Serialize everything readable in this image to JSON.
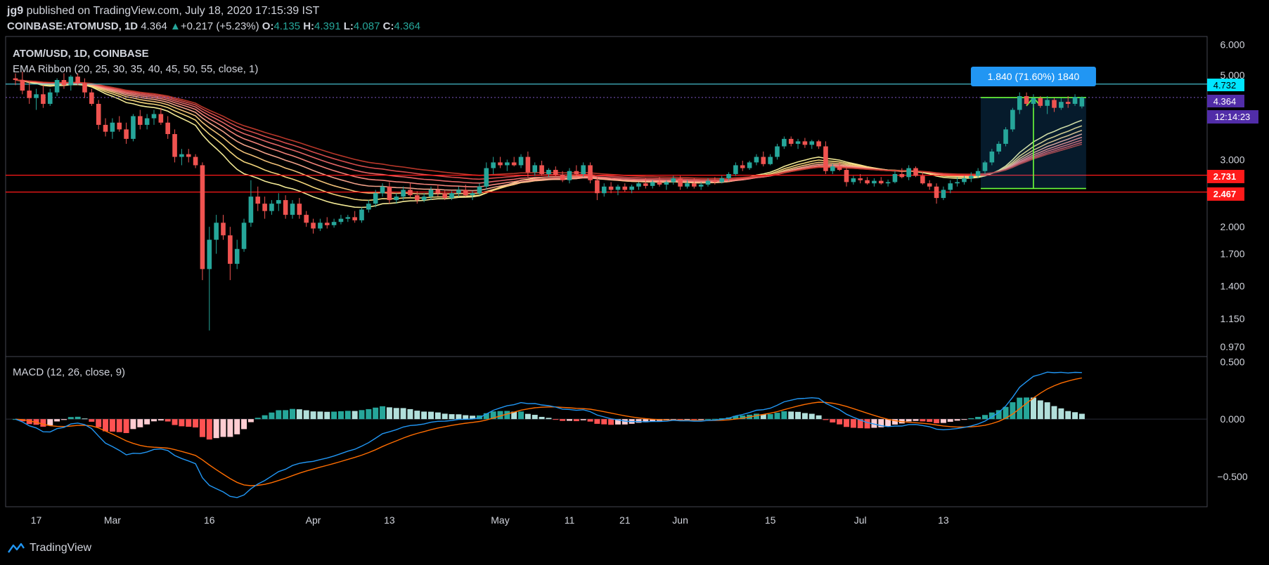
{
  "header": {
    "user": "jg9",
    "published": "published on TradingView.com, July 18, 2020 17:15:39 IST",
    "symbol": "COINBASE:ATOMUSD, 1D",
    "last": "4.364",
    "change_arrow": "▲",
    "change": "+0.217 (+5.23%)",
    "o_label": "O:",
    "o": "4.135",
    "h_label": "H:",
    "h": "4.391",
    "l_label": "L:",
    "l": "4.087",
    "c_label": "C:",
    "c": "4.364"
  },
  "price_pane": {
    "title": "ATOM/USD, 1D, COINBASE",
    "indicator": "EMA Ribbon (20, 25, 30, 35, 40, 45, 50, 55, close, 1)",
    "measure_label": "1.840 (71.60%) 1840"
  },
  "macd_pane": {
    "title": "MACD (12, 26, close, 9)"
  },
  "price_tags": {
    "resistance": "4.732",
    "last": "4.364",
    "countdown": "12:14:23",
    "support1": "2.731",
    "support2": "2.467"
  },
  "footer": {
    "brand": "TradingView"
  },
  "colors": {
    "up": "#26a69a",
    "down": "#ef5350",
    "cyan": "#4dd0e1",
    "red_line": "#ff1a1a",
    "macd": "#2196f3",
    "signal": "#ff6d00",
    "measure": "#2196f3",
    "lime": "#6cff3a"
  },
  "chart_data": [
    {
      "type": "candlestick",
      "title": "ATOM/USD, 1D, COINBASE",
      "x_ticks": [
        "17",
        "Mar",
        "16",
        "Apr",
        "13",
        "May",
        "11",
        "21",
        "Jun",
        "15",
        "Jul",
        "13"
      ],
      "y_ticks": [
        "6.000",
        "5.000",
        "3.000",
        "2.000",
        "1.700",
        "1.400",
        "1.150",
        "0.970"
      ],
      "log_scale": true,
      "ylim": [
        0.93,
        6.2
      ],
      "horizontal_lines": [
        4.732,
        2.731,
        2.467
      ],
      "last_price": 4.364,
      "measure": {
        "from": 2.52,
        "to": 4.364,
        "label": "1.840 (71.60%) 1840"
      },
      "candles": [
        [
          4.9,
          5.05,
          4.7,
          4.85
        ],
        [
          4.85,
          5.1,
          4.45,
          4.55
        ],
        [
          4.55,
          4.8,
          4.2,
          4.35
        ],
        [
          4.35,
          4.6,
          4.05,
          4.45
        ],
        [
          4.45,
          4.7,
          4.1,
          4.2
        ],
        [
          4.2,
          4.6,
          4.15,
          4.5
        ],
        [
          4.5,
          4.9,
          4.4,
          4.85
        ],
        [
          4.85,
          5.05,
          4.6,
          4.7
        ],
        [
          4.7,
          5.0,
          4.55,
          4.95
        ],
        [
          4.95,
          5.05,
          4.7,
          4.75
        ],
        [
          4.75,
          4.9,
          4.35,
          4.5
        ],
        [
          4.5,
          4.6,
          4.15,
          4.2
        ],
        [
          4.2,
          4.3,
          3.6,
          3.7
        ],
        [
          3.7,
          3.85,
          3.45,
          3.55
        ],
        [
          3.55,
          3.85,
          3.4,
          3.75
        ],
        [
          3.75,
          3.9,
          3.55,
          3.6
        ],
        [
          3.6,
          3.75,
          3.3,
          3.4
        ],
        [
          3.4,
          3.95,
          3.35,
          3.9
        ],
        [
          3.9,
          4.05,
          3.6,
          3.7
        ],
        [
          3.7,
          3.95,
          3.6,
          3.85
        ],
        [
          3.85,
          4.05,
          3.7,
          3.95
        ],
        [
          3.95,
          4.1,
          3.7,
          3.75
        ],
        [
          3.75,
          3.9,
          3.4,
          3.5
        ],
        [
          3.5,
          3.6,
          2.95,
          3.05
        ],
        [
          3.05,
          3.2,
          2.9,
          3.1
        ],
        [
          3.1,
          3.2,
          2.95,
          3.05
        ],
        [
          3.05,
          3.1,
          2.85,
          2.9
        ],
        [
          2.9,
          2.95,
          1.45,
          1.55
        ],
        [
          1.55,
          2.0,
          1.07,
          1.85
        ],
        [
          1.85,
          2.15,
          1.7,
          2.05
        ],
        [
          2.05,
          2.15,
          1.85,
          1.9
        ],
        [
          1.9,
          2.0,
          1.45,
          1.6
        ],
        [
          1.6,
          1.85,
          1.55,
          1.75
        ],
        [
          1.75,
          2.1,
          1.72,
          2.05
        ],
        [
          2.05,
          2.65,
          2.0,
          2.4
        ],
        [
          2.4,
          2.55,
          2.2,
          2.3
        ],
        [
          2.3,
          2.4,
          2.1,
          2.2
        ],
        [
          2.2,
          2.35,
          2.15,
          2.3
        ],
        [
          2.3,
          2.45,
          2.2,
          2.35
        ],
        [
          2.35,
          2.42,
          2.1,
          2.15
        ],
        [
          2.15,
          2.35,
          2.1,
          2.3
        ],
        [
          2.3,
          2.38,
          2.1,
          2.15
        ],
        [
          2.15,
          2.2,
          2.0,
          2.05
        ],
        [
          2.05,
          2.1,
          1.92,
          1.98
        ],
        [
          1.98,
          2.1,
          1.95,
          2.05
        ],
        [
          2.05,
          2.12,
          1.98,
          2.02
        ],
        [
          2.02,
          2.1,
          1.99,
          2.06
        ],
        [
          2.06,
          2.15,
          2.03,
          2.1
        ],
        [
          2.1,
          2.15,
          2.06,
          2.12
        ],
        [
          2.12,
          2.2,
          2.05,
          2.08
        ],
        [
          2.08,
          2.25,
          2.05,
          2.22
        ],
        [
          2.22,
          2.35,
          2.18,
          2.3
        ],
        [
          2.3,
          2.5,
          2.25,
          2.45
        ],
        [
          2.45,
          2.6,
          2.4,
          2.55
        ],
        [
          2.55,
          2.62,
          2.3,
          2.35
        ],
        [
          2.35,
          2.45,
          2.3,
          2.4
        ],
        [
          2.4,
          2.55,
          2.35,
          2.5
        ],
        [
          2.5,
          2.6,
          2.38,
          2.42
        ],
        [
          2.42,
          2.48,
          2.3,
          2.35
        ],
        [
          2.35,
          2.45,
          2.32,
          2.4
        ],
        [
          2.4,
          2.55,
          2.35,
          2.5
        ],
        [
          2.5,
          2.58,
          2.4,
          2.45
        ],
        [
          2.45,
          2.5,
          2.35,
          2.38
        ],
        [
          2.38,
          2.48,
          2.35,
          2.45
        ],
        [
          2.45,
          2.55,
          2.4,
          2.5
        ],
        [
          2.5,
          2.58,
          2.4,
          2.42
        ],
        [
          2.42,
          2.48,
          2.35,
          2.45
        ],
        [
          2.45,
          2.6,
          2.42,
          2.55
        ],
        [
          2.55,
          2.95,
          2.5,
          2.85
        ],
        [
          2.85,
          3.05,
          2.75,
          2.95
        ],
        [
          2.95,
          3.05,
          2.85,
          2.9
        ],
        [
          2.9,
          3.0,
          2.8,
          2.95
        ],
        [
          2.95,
          3.05,
          2.88,
          2.9
        ],
        [
          2.9,
          3.1,
          2.85,
          3.05
        ],
        [
          3.05,
          3.15,
          2.7,
          2.78
        ],
        [
          2.78,
          2.95,
          2.72,
          2.9
        ],
        [
          2.9,
          2.98,
          2.72,
          2.75
        ],
        [
          2.75,
          2.85,
          2.7,
          2.82
        ],
        [
          2.82,
          2.88,
          2.7,
          2.74
        ],
        [
          2.74,
          2.8,
          2.62,
          2.65
        ],
        [
          2.65,
          2.85,
          2.6,
          2.8
        ],
        [
          2.8,
          2.9,
          2.72,
          2.75
        ],
        [
          2.75,
          2.95,
          2.7,
          2.9
        ],
        [
          2.9,
          2.95,
          2.6,
          2.65
        ],
        [
          2.65,
          2.7,
          2.35,
          2.45
        ],
        [
          2.45,
          2.6,
          2.4,
          2.55
        ],
        [
          2.55,
          2.62,
          2.45,
          2.5
        ],
        [
          2.5,
          2.58,
          2.42,
          2.55
        ],
        [
          2.55,
          2.6,
          2.47,
          2.5
        ],
        [
          2.5,
          2.58,
          2.45,
          2.55
        ],
        [
          2.55,
          2.62,
          2.5,
          2.6
        ],
        [
          2.6,
          2.68,
          2.52,
          2.56
        ],
        [
          2.56,
          2.65,
          2.52,
          2.62
        ],
        [
          2.62,
          2.7,
          2.55,
          2.58
        ],
        [
          2.58,
          2.65,
          2.5,
          2.62
        ],
        [
          2.62,
          2.72,
          2.58,
          2.68
        ],
        [
          2.68,
          2.72,
          2.5,
          2.55
        ],
        [
          2.55,
          2.65,
          2.52,
          2.6
        ],
        [
          2.6,
          2.68,
          2.52,
          2.55
        ],
        [
          2.55,
          2.62,
          2.5,
          2.58
        ],
        [
          2.58,
          2.68,
          2.55,
          2.64
        ],
        [
          2.64,
          2.7,
          2.58,
          2.62
        ],
        [
          2.62,
          2.72,
          2.6,
          2.68
        ],
        [
          2.68,
          2.78,
          2.64,
          2.75
        ],
        [
          2.75,
          2.95,
          2.72,
          2.9
        ],
        [
          2.9,
          2.98,
          2.8,
          2.85
        ],
        [
          2.85,
          2.98,
          2.82,
          2.95
        ],
        [
          2.95,
          3.1,
          2.9,
          3.05
        ],
        [
          3.05,
          3.15,
          2.88,
          2.92
        ],
        [
          2.92,
          3.1,
          2.9,
          3.05
        ],
        [
          3.05,
          3.3,
          3.0,
          3.25
        ],
        [
          3.25,
          3.45,
          3.2,
          3.4
        ],
        [
          3.4,
          3.45,
          3.25,
          3.3
        ],
        [
          3.3,
          3.4,
          3.2,
          3.35
        ],
        [
          3.35,
          3.42,
          3.22,
          3.28
        ],
        [
          3.28,
          3.38,
          3.2,
          3.35
        ],
        [
          3.35,
          3.38,
          3.2,
          3.25
        ],
        [
          3.25,
          3.35,
          2.75,
          2.8
        ],
        [
          2.8,
          2.92,
          2.75,
          2.88
        ],
        [
          2.88,
          2.95,
          2.8,
          2.82
        ],
        [
          2.82,
          2.88,
          2.55,
          2.62
        ],
        [
          2.62,
          2.72,
          2.58,
          2.68
        ],
        [
          2.68,
          2.75,
          2.6,
          2.65
        ],
        [
          2.65,
          2.7,
          2.58,
          2.6
        ],
        [
          2.6,
          2.68,
          2.55,
          2.64
        ],
        [
          2.64,
          2.7,
          2.58,
          2.6
        ],
        [
          2.6,
          2.66,
          2.55,
          2.62
        ],
        [
          2.62,
          2.8,
          2.6,
          2.75
        ],
        [
          2.75,
          2.85,
          2.68,
          2.7
        ],
        [
          2.7,
          2.9,
          2.65,
          2.85
        ],
        [
          2.85,
          2.88,
          2.7,
          2.72
        ],
        [
          2.72,
          2.78,
          2.58,
          2.6
        ],
        [
          2.6,
          2.65,
          2.5,
          2.55
        ],
        [
          2.55,
          2.6,
          2.3,
          2.38
        ],
        [
          2.38,
          2.55,
          2.35,
          2.5
        ],
        [
          2.5,
          2.65,
          2.45,
          2.6
        ],
        [
          2.6,
          2.7,
          2.55,
          2.62
        ],
        [
          2.62,
          2.72,
          2.58,
          2.68
        ],
        [
          2.68,
          2.78,
          2.62,
          2.72
        ],
        [
          2.72,
          2.85,
          2.68,
          2.8
        ],
        [
          2.8,
          2.98,
          2.75,
          2.95
        ],
        [
          2.95,
          3.2,
          2.9,
          3.15
        ],
        [
          3.15,
          3.35,
          3.1,
          3.3
        ],
        [
          3.3,
          3.65,
          3.25,
          3.6
        ],
        [
          3.6,
          4.1,
          3.55,
          4.05
        ],
        [
          4.05,
          4.5,
          3.95,
          4.4
        ],
        [
          4.4,
          4.5,
          4.15,
          4.2
        ],
        [
          4.2,
          4.45,
          4.1,
          4.35
        ],
        [
          4.35,
          4.4,
          4.1,
          4.15
        ],
        [
          4.15,
          4.4,
          3.95,
          4.3
        ],
        [
          4.3,
          4.35,
          4.0,
          4.1
        ],
        [
          4.1,
          4.35,
          4.05,
          4.25
        ],
        [
          4.25,
          4.4,
          4.1,
          4.2
        ],
        [
          4.2,
          4.45,
          4.15,
          4.38
        ],
        [
          4.135,
          4.391,
          4.087,
          4.364
        ]
      ],
      "ema_ribbon_periods": [
        20,
        25,
        30,
        35,
        40,
        45,
        50,
        55
      ]
    },
    {
      "type": "line",
      "title": "MACD (12, 26, close, 9)",
      "y_ticks": [
        "0.500",
        "0.000",
        "−0.500"
      ],
      "ylim": [
        -0.75,
        0.52
      ],
      "series": [
        {
          "name": "MACD"
        },
        {
          "name": "Signal"
        },
        {
          "name": "Histogram"
        }
      ]
    }
  ]
}
